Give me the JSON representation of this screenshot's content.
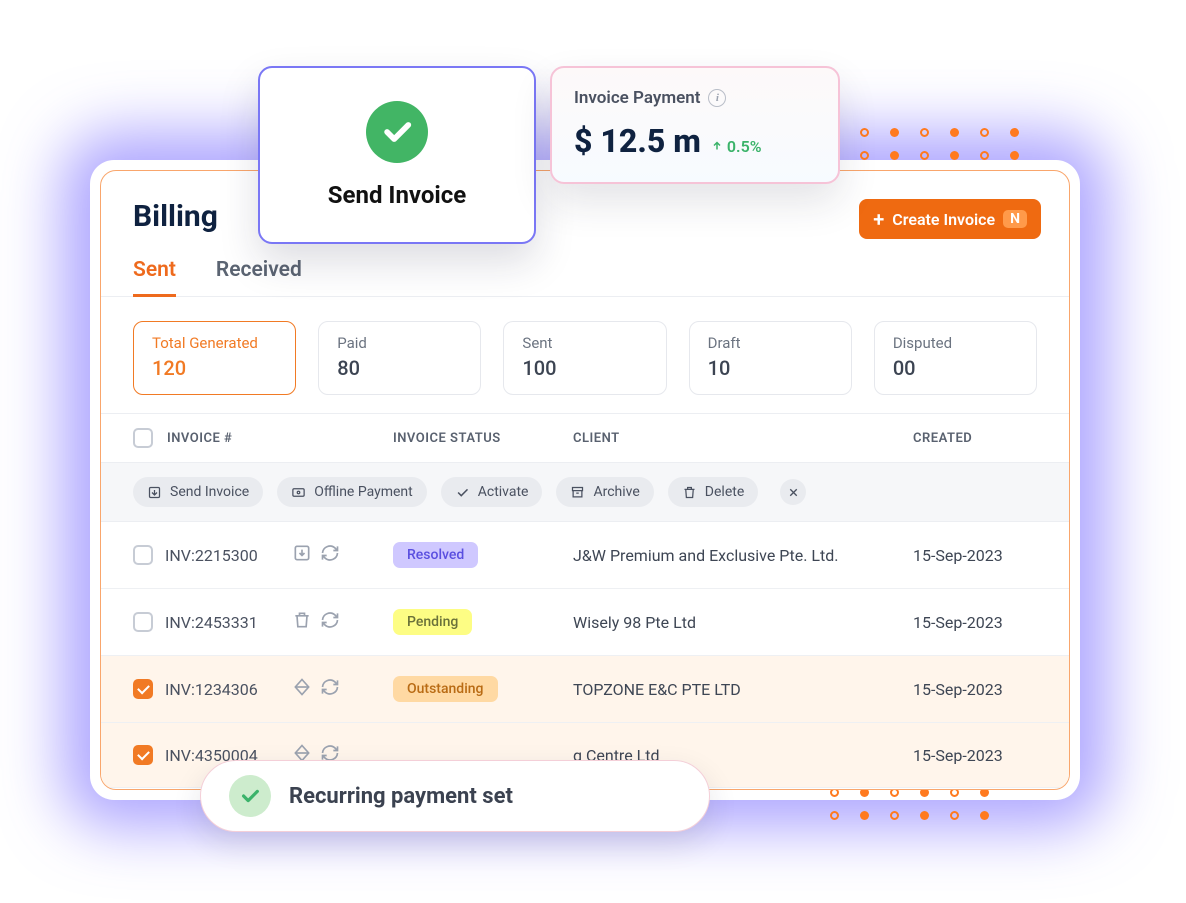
{
  "page": {
    "title": "Billing"
  },
  "tabs": {
    "sent": "Sent",
    "received": "Received",
    "active": "sent"
  },
  "stats": [
    {
      "label": "Total Generated",
      "value": "120",
      "active": true
    },
    {
      "label": "Paid",
      "value": "80"
    },
    {
      "label": "Sent",
      "value": "100"
    },
    {
      "label": "Draft",
      "value": "10"
    },
    {
      "label": "Disputed",
      "value": "00"
    }
  ],
  "columns": {
    "invoice": "INVOICE #",
    "status": "INVOICE STATUS",
    "client": "CLIENT",
    "created": "CREATED"
  },
  "actions": {
    "send": "Send Invoice",
    "offline": "Offline Payment",
    "activate": "Activate",
    "archive": "Archive",
    "delete": "Delete"
  },
  "rows": [
    {
      "selected": false,
      "invoice": "INV:2215300",
      "icon1": "archive-in",
      "icon2": "recur",
      "status": "Resolved",
      "status_class": "resolved",
      "client": "J&W Premium and Exclusive Pte. Ltd.",
      "created": "15-Sep-2023"
    },
    {
      "selected": false,
      "invoice": "INV:2453331",
      "icon1": "trash",
      "icon2": "recur",
      "status": "Pending",
      "status_class": "pending",
      "client": "Wisely 98 Pte Ltd",
      "created": "15-Sep-2023"
    },
    {
      "selected": true,
      "invoice": "INV:1234306",
      "icon1": "diamond",
      "icon2": "recur",
      "status": "Outstanding",
      "status_class": "outstanding",
      "client": "TOPZONE E&C PTE LTD",
      "created": "15-Sep-2023"
    },
    {
      "selected": true,
      "invoice": "INV:4350004",
      "icon1": "diamond",
      "icon2": "recur",
      "status": "",
      "status_class": "",
      "client": "g Centre Ltd",
      "created": "15-Sep-2023"
    }
  ],
  "create_button": {
    "label": "Create Invoice",
    "badge": "N"
  },
  "send_card": {
    "label": "Send Invoice"
  },
  "kpi_card": {
    "title": "Invoice Payment",
    "value": "$ 12.5 m",
    "delta": "0.5%",
    "delta_dir": "up"
  },
  "toast": {
    "text": "Recurring payment set"
  }
}
